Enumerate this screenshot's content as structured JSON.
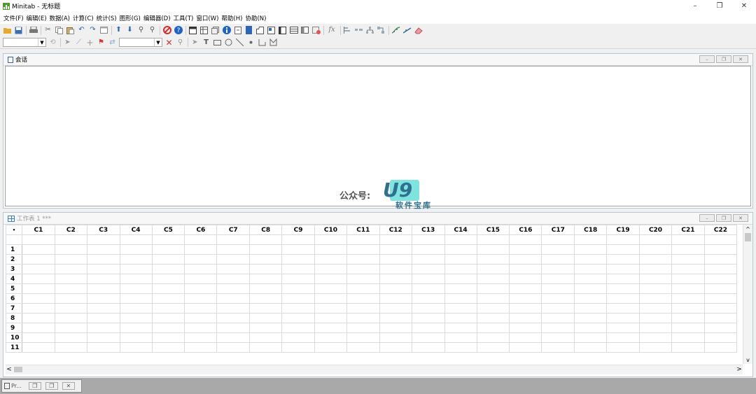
{
  "app": {
    "title": "Minitab - 无标题"
  },
  "window_controls": {
    "minimize": "–",
    "restore": "❐",
    "close": "✕"
  },
  "menu": [
    "文件(F)",
    "编辑(E)",
    "数据(A)",
    "计算(C)",
    "统计(S)",
    "图形(G)",
    "编辑器(D)",
    "工具(T)",
    "窗口(W)",
    "帮助(H)",
    "协助(N)"
  ],
  "toolbar1_icons": [
    "open-folder-icon",
    "save-icon",
    "print-icon",
    "cut-icon",
    "copy-icon",
    "paste-icon",
    "undo-icon",
    "redo-icon",
    "window-icon",
    "up-arrow-icon",
    "down-arrow-icon",
    "find-icon",
    "find-next-icon",
    "cancel-icon",
    "help-icon",
    "session-icon",
    "worksheet-icon",
    "new-worksheet-icon",
    "info-icon",
    "history-icon",
    "project-icon",
    "graph-folder-icon",
    "report-icon",
    "table-icon",
    "layout-icon",
    "graph-icon",
    "function-icon",
    "bar-icon",
    "stack-icon",
    "tree-icon",
    "link-icon",
    "chart-edit-icon",
    "curve-icon",
    "eraser-icon"
  ],
  "toolbar2_icons": [
    "brush-icon",
    "pointer-icon",
    "regression-icon",
    "crosshair-icon",
    "flag-icon",
    "swap-icon",
    "delete-x-icon",
    "zoom-icon",
    "select-icon",
    "text-icon",
    "rectangle-icon",
    "ellipse-icon",
    "line-icon",
    "dot-icon",
    "polyline-icon",
    "polygon-icon"
  ],
  "session": {
    "title": "会话"
  },
  "worksheet": {
    "title": "工作表 1 ***",
    "corner": "•",
    "columns": [
      "C1",
      "C2",
      "C3",
      "C4",
      "C5",
      "C6",
      "C7",
      "C8",
      "C9",
      "C10",
      "C11",
      "C12",
      "C13",
      "C14",
      "C15",
      "C16",
      "C17",
      "C18",
      "C19",
      "C20",
      "C21",
      "C22"
    ],
    "rows": [
      "1",
      "2",
      "3",
      "4",
      "5",
      "6",
      "7",
      "8",
      "9",
      "10",
      "11"
    ]
  },
  "scroll": {
    "up": "^",
    "down": "v",
    "left": "<",
    "right": ">"
  },
  "taskbar": {
    "minimized_label": "Pr..."
  },
  "watermark": {
    "prefix": "公众号:",
    "logo": "U9",
    "suffix": "软件宝库"
  },
  "colors": {
    "accent_green": "#4e9a2f",
    "cancel_red": "#d32f2f",
    "help_blue": "#1f63c6",
    "watermark_teal": "#7fe3e0"
  }
}
